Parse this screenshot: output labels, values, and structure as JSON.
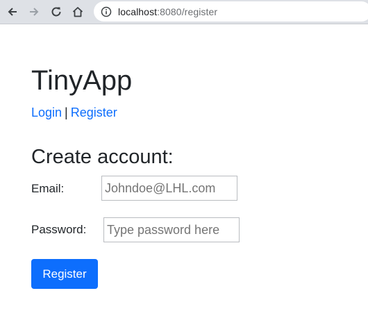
{
  "browser": {
    "url_host": "localhost",
    "url_rest": ":8080/register",
    "icons": [
      "back-arrow-icon",
      "forward-arrow-icon",
      "reload-icon",
      "home-icon",
      "info-icon"
    ]
  },
  "page": {
    "app_title": "TinyApp",
    "nav": {
      "login": "Login",
      "separator": "|",
      "register": "Register"
    },
    "heading": "Create account:",
    "form": {
      "email_label": "Email:",
      "email_placeholder": "Johndoe@LHL.com",
      "password_label": "Password:",
      "password_placeholder": "Type password here",
      "submit_label": "Register"
    }
  },
  "colors": {
    "link": "#0d6efd",
    "button": "#0d6efd",
    "toolbar": "#dee1e6"
  }
}
